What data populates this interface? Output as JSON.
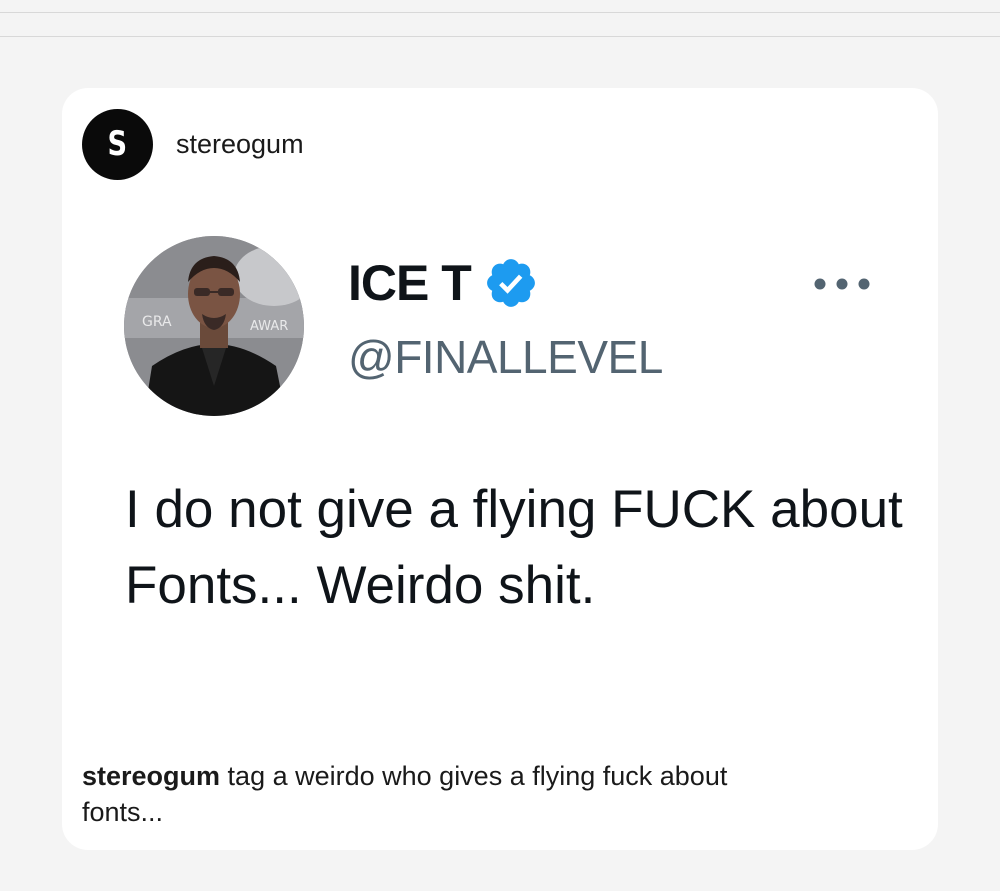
{
  "post": {
    "account_name": "stereogum",
    "logo_letter": "S"
  },
  "tweet": {
    "display_name": "ICE T",
    "handle": "@FINALLEVEL",
    "text": "I do not give a flying FUCK about Fonts... Weirdo shit.",
    "avatar_backdrop_text_left": "GRA",
    "avatar_backdrop_text_right": "AWAR"
  },
  "caption": {
    "username": "stereogum",
    "text": " tag a weirdo who gives a flying fuck about fonts..."
  },
  "colors": {
    "verified_badge": "#1d9bf0",
    "handle": "#536471",
    "text": "#0f1419",
    "card_background": "#ffffff",
    "page_background": "#f4f4f4"
  },
  "icons": [
    "verified-badge-icon",
    "more-options-icon"
  ]
}
